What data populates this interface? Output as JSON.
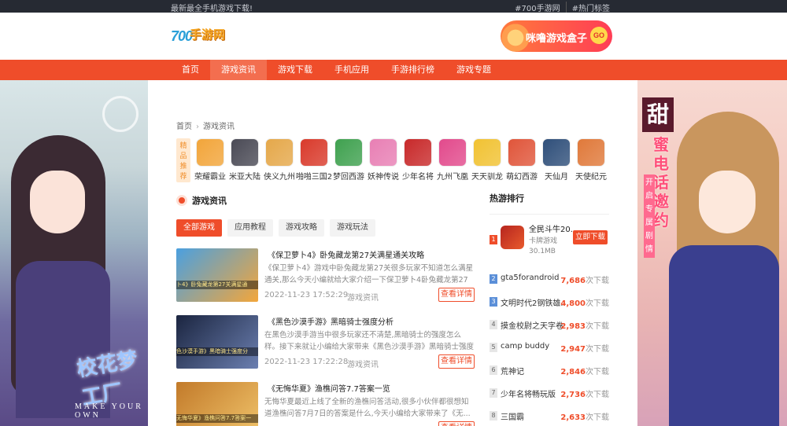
{
  "topbar": {
    "tagline": "最新最全手机游戏下载!",
    "links": [
      "#700手游网",
      "#热门标签"
    ]
  },
  "header": {
    "logo_num": "700",
    "logo_text": "手游网",
    "banner_text": "咪噜游戏盒子",
    "banner_go": "GO"
  },
  "nav": {
    "items": [
      "首页",
      "游戏资讯",
      "游戏下载",
      "手机应用",
      "手游排行榜",
      "游戏专题"
    ],
    "active_index": 1
  },
  "skins": {
    "left_title": "校花梦工厂",
    "left_caption": "MAKE YOUR OWN",
    "right_char": "甜",
    "right_title": "蜜电话邀约",
    "right_sub": "开启专属剧情"
  },
  "breadcrumb": {
    "home": "首页",
    "sep": "›",
    "current": "游戏资讯"
  },
  "featured": {
    "tag": [
      "精",
      "品",
      "推",
      "荐"
    ],
    "games": [
      {
        "name": "荣耀霸业",
        "color": "#f2a53a"
      },
      {
        "name": "米亚大陆",
        "color": "#4a4a55"
      },
      {
        "name": "侠义九州",
        "color": "#e5a84a"
      },
      {
        "name": "啪啪三国2",
        "color": "#d93a2b"
      },
      {
        "name": "梦回西游",
        "color": "#3fa14f"
      },
      {
        "name": "妖神传说",
        "color": "#e87fb4"
      },
      {
        "name": "少年名将",
        "color": "#c8292a"
      },
      {
        "name": "九州飞凰",
        "color": "#e24a8c"
      },
      {
        "name": "天天驯龙",
        "color": "#f1c232"
      },
      {
        "name": "萌幻西游",
        "color": "#e0553a"
      },
      {
        "name": "天仙月",
        "color": "#2f4f7a"
      },
      {
        "name": "天使纪元",
        "color": "#e0793a"
      }
    ]
  },
  "section": {
    "title": "游戏资讯"
  },
  "tabs": [
    "全部游戏",
    "应用教程",
    "游戏攻略",
    "游戏玩法"
  ],
  "articles": [
    {
      "title": "《保卫萝卜4》卧兔藏龙第27关满星通关攻略",
      "desc": "《保卫萝卜4》游戏中卧兔藏龙第27关很多玩家不知道怎么满星通关,那么今天小编就给大家介绍一下保卫萝卜4卧兔藏龙第27关...",
      "date": "2022-11-23 17:52:29",
      "category": "游戏资讯",
      "more": "查看详情",
      "thumb_caption": "卜4》卧兔藏龙第27关满星通",
      "thumb_colors": [
        "#4aa0e0",
        "#f3a63b"
      ]
    },
    {
      "title": "《黑色沙漠手游》黑暗骑士强度分析",
      "desc": "在黑色沙漠手游当中很多玩家还不清楚,黑暗骑士的强度怎么样。接下来就让小编给大家带来《黑色沙漠手游》黑暗骑士强度分...",
      "date": "2022-11-23 17:22:28",
      "category": "游戏资讯",
      "more": "查看详情",
      "thumb_caption": "色沙漠手游》黑暗骑士强度分",
      "thumb_colors": [
        "#1b2540",
        "#6b7fb0"
      ]
    },
    {
      "title": "《无悔华夏》渔樵问答7.7答案一览",
      "desc": "无悔华夏最近上线了全新的渔樵问答活动,很多小伙伴都很想知道渔樵问答7月7日的答案是什么,今天小编给大家带来了《无...",
      "date": "",
      "category": "",
      "more": "查看详情",
      "thumb_caption": "无悔华夏》渔樵问答7.7答案一",
      "thumb_colors": [
        "#c27a2a",
        "#f0c36a"
      ]
    }
  ],
  "ranking": {
    "title": "热游排行",
    "top": {
      "rank": "1",
      "name": "全民斗牛20...",
      "category": "卡牌游戏",
      "size": "30.1MB",
      "button": "立即下载"
    },
    "items": [
      {
        "rank": "2",
        "name": "gta5forandroid",
        "count": "7,686",
        "suffix": "次下载",
        "hot": true
      },
      {
        "rank": "3",
        "name": "文明时代2钢铁雄...",
        "count": "4,800",
        "suffix": "次下载",
        "hot": true
      },
      {
        "rank": "4",
        "name": "摸金校尉之天字卷",
        "count": "2,983",
        "suffix": "次下载",
        "hot": false
      },
      {
        "rank": "5",
        "name": "camp buddy",
        "count": "2,947",
        "suffix": "次下载",
        "hot": false
      },
      {
        "rank": "6",
        "name": "荒神记",
        "count": "2,846",
        "suffix": "次下载",
        "hot": false
      },
      {
        "rank": "7",
        "name": "少年名将畅玩版",
        "count": "2,736",
        "suffix": "次下载",
        "hot": false
      },
      {
        "rank": "8",
        "name": "三国霸",
        "count": "2,633",
        "suffix": "次下载",
        "hot": false
      }
    ]
  }
}
